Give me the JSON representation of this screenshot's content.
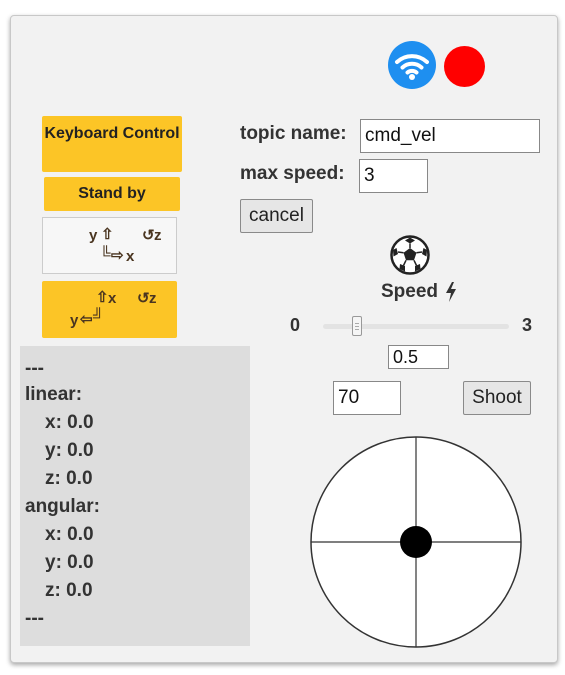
{
  "status": {
    "connection_icon": "wifi-icon",
    "connection_color": "#1e8ff0",
    "record_color": "#ff0000"
  },
  "controls": {
    "keyboard_control": "Keyboard Control",
    "stand_by": "Stand by",
    "accent_color": "#fcc526",
    "mode1": {
      "y_label": "y",
      "y_arrow": "⇧",
      "rot_symbol": "↺",
      "rot_label": "z",
      "corner": "╚",
      "x_arrow": "⇨",
      "x_label": "x"
    },
    "mode2": {
      "x_arrow": "⇧",
      "x_label": "x",
      "rot_symbol": "↺",
      "rot_label": "z",
      "y_label": "y",
      "y_arrow": "⇦",
      "corner": "╝"
    }
  },
  "form": {
    "topic_label": "topic name:",
    "topic_value": "cmd_vel",
    "max_speed_label": "max speed:",
    "max_speed_value": "3",
    "cancel_label": "cancel"
  },
  "speed": {
    "ball_icon": "soccer-ball-icon",
    "title": "Speed",
    "bolt_icon": "lightning-bolt-icon",
    "min": "0",
    "max": "3",
    "value": "0.5",
    "shoot_value": "70",
    "shoot_label": "Shoot"
  },
  "twist": {
    "lines": [
      "---",
      "linear:",
      "x: 0.0",
      "y: 0.0",
      "z: 0.0",
      "angular:",
      "x: 0.0",
      "y: 0.0",
      "z: 0.0",
      "---"
    ]
  },
  "joystick": {
    "x": 0.0,
    "y": 0.0
  }
}
